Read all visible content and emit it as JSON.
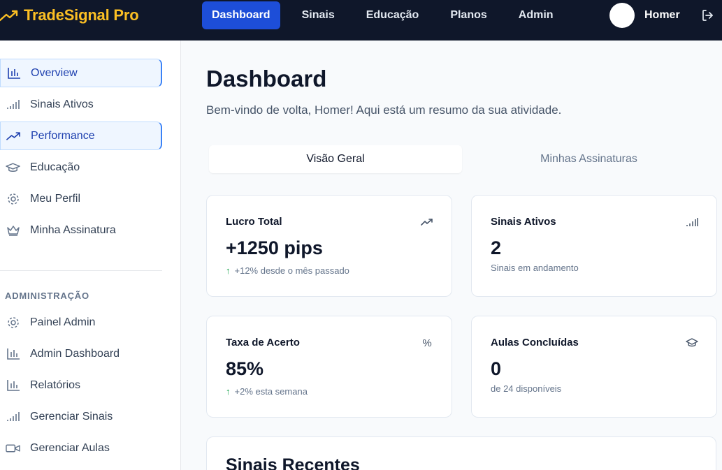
{
  "brand": {
    "name": "TradeSignal Pro",
    "color": "#fbbf24"
  },
  "nav": {
    "items": [
      {
        "label": "Dashboard",
        "active": true
      },
      {
        "label": "Sinais",
        "active": false
      },
      {
        "label": "Educação",
        "active": false
      },
      {
        "label": "Planos",
        "active": false
      },
      {
        "label": "Admin",
        "active": false
      }
    ]
  },
  "user": {
    "name": "Homer"
  },
  "sidebar": {
    "items": [
      {
        "label": "Overview",
        "icon": "bar-chart-icon",
        "active": true
      },
      {
        "label": "Sinais Ativos",
        "icon": "signal-icon",
        "active": false
      },
      {
        "label": "Performance",
        "icon": "trending-up-icon",
        "active": true
      },
      {
        "label": "Educação",
        "icon": "graduation-cap-icon",
        "active": false
      },
      {
        "label": "Meu Perfil",
        "icon": "gear-icon",
        "active": false
      },
      {
        "label": "Minha Assinatura",
        "icon": "crown-icon",
        "active": false
      }
    ],
    "admin_section": "ADMINISTRAÇÃO",
    "admin_items": [
      {
        "label": "Painel Admin",
        "icon": "gear-icon"
      },
      {
        "label": "Admin Dashboard",
        "icon": "bar-chart-icon"
      },
      {
        "label": "Relatórios",
        "icon": "bar-chart-icon"
      },
      {
        "label": "Gerenciar Sinais",
        "icon": "signal-icon"
      },
      {
        "label": "Gerenciar Aulas",
        "icon": "video-icon"
      }
    ]
  },
  "main": {
    "title": "Dashboard",
    "subtitle": "Bem-vindo de volta, Homer! Aqui está um resumo da sua atividade.",
    "tabs": [
      {
        "label": "Visão Geral",
        "active": true
      },
      {
        "label": "Minhas Assinaturas",
        "active": false
      }
    ],
    "cards": [
      {
        "title": "Lucro Total",
        "value": "+1250 pips",
        "note": "+12% desde o mês passado",
        "trend": true,
        "icon": "trending-up-icon"
      },
      {
        "title": "Sinais Ativos",
        "value": "2",
        "note": "Sinais em andamento",
        "trend": false,
        "icon": "signal-icon"
      },
      {
        "title": "Taxa de Acerto",
        "value": "85%",
        "note": "+2% esta semana",
        "trend": true,
        "icon": "percent-icon"
      },
      {
        "title": "Aulas Concluídas",
        "value": "0",
        "note": "de 24 disponíveis",
        "trend": false,
        "icon": "graduation-cap-icon"
      }
    ],
    "recent_title": "Sinais Recentes"
  },
  "colors": {
    "accent": "#1d4ed8",
    "nav_bg": "#0f172a",
    "positive": "#16a34a"
  }
}
